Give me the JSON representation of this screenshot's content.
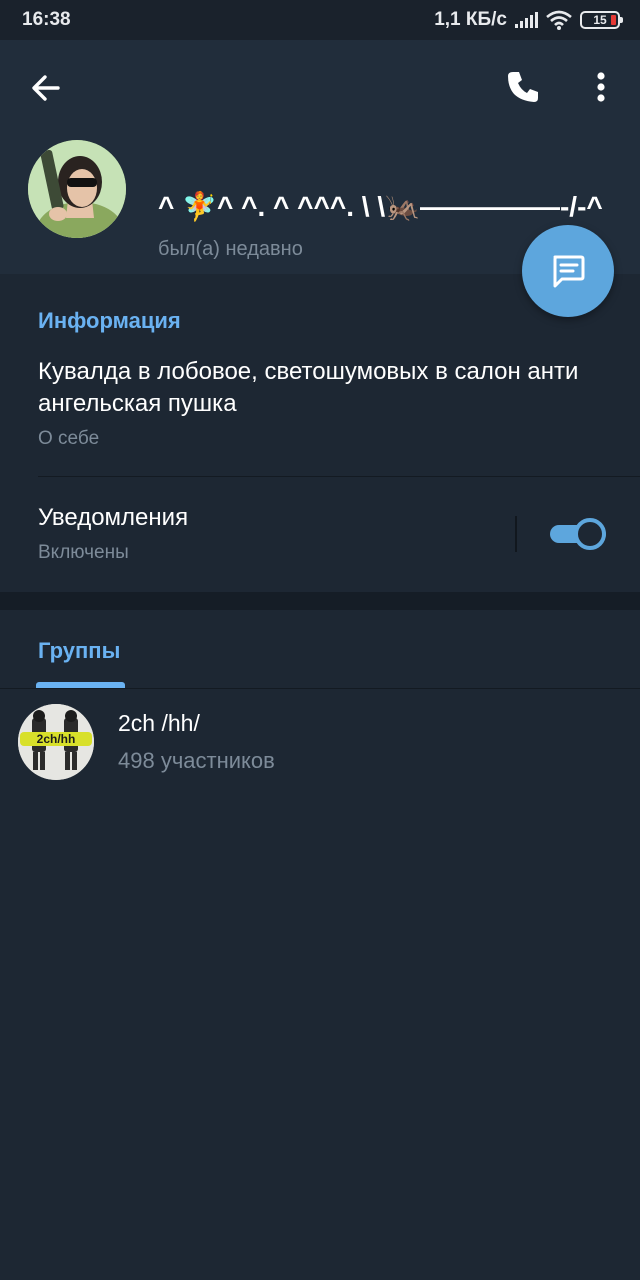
{
  "status_bar": {
    "time": "16:38",
    "net_speed": "1,1 КБ/с",
    "battery": "15",
    "icons": [
      "signal-icon",
      "wifi-icon",
      "battery-icon"
    ]
  },
  "header": {
    "icons": [
      "back-arrow-icon",
      "phone-icon",
      "more-vertical-icon"
    ],
    "name": "^ 🧚^ ^. ^ ^^^. \\ \\🦗—————-/-^",
    "status": "был(а) недавно",
    "fab_icon": "message-icon"
  },
  "info": {
    "title": "Информация",
    "about": "Кувалда в лобовое, светошумовых в салон анти ангельская пушка",
    "about_label": "О себе",
    "notifications_label": "Уведомления",
    "notifications_value": "Включены",
    "notifications_enabled": true
  },
  "groups": {
    "tab_label": "Группы",
    "items": [
      {
        "name": "2ch /hh/",
        "members": "498 участников",
        "avatar_text": "2ch/hh"
      }
    ]
  },
  "colors": {
    "background": "#1d2733",
    "header": "#212d3b",
    "accent": "#5da6dd",
    "section_title": "#6ab2f2",
    "secondary_text": "#7d8b99"
  }
}
